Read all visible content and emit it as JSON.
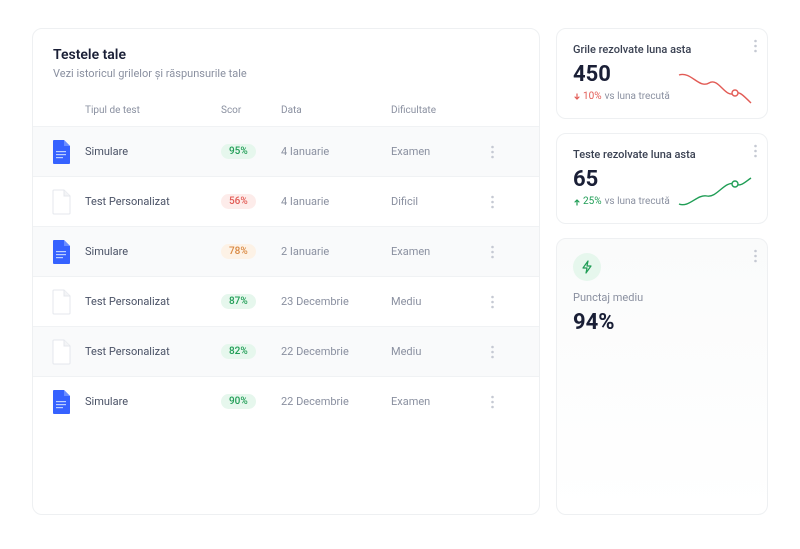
{
  "panel": {
    "title": "Testele tale",
    "subtitle": "Vezi istoricul grilelor și răspunsurile tale",
    "columns": {
      "type": "Tipul de test",
      "score": "Scor",
      "date": "Data",
      "difficulty": "Dificultate"
    },
    "rows": [
      {
        "name": "Simulare",
        "score": "95%",
        "score_tone": "green",
        "date": "4 Ianuarie",
        "difficulty": "Examen",
        "icon": "blue",
        "alt": true
      },
      {
        "name": "Test Personalizat",
        "score": "56%",
        "score_tone": "red",
        "date": "4 Ianuarie",
        "difficulty": "Dificil",
        "icon": "white",
        "alt": false
      },
      {
        "name": "Simulare",
        "score": "78%",
        "score_tone": "orange",
        "date": "2 Ianuarie",
        "difficulty": "Examen",
        "icon": "blue",
        "alt": true
      },
      {
        "name": "Test Personalizat",
        "score": "87%",
        "score_tone": "green",
        "date": "23 Decembrie",
        "difficulty": "Mediu",
        "icon": "white",
        "alt": false
      },
      {
        "name": "Test Personalizat",
        "score": "82%",
        "score_tone": "green",
        "date": "22 Decembrie",
        "difficulty": "Mediu",
        "icon": "white",
        "alt": true
      },
      {
        "name": "Simulare",
        "score": "90%",
        "score_tone": "green",
        "date": "22 Decembrie",
        "difficulty": "Examen",
        "icon": "blue",
        "alt": false
      }
    ]
  },
  "cards": {
    "grids": {
      "title": "Grile rezolvate luna asta",
      "value": "450",
      "delta": "10%",
      "delta_dir": "down",
      "vs": "vs luna trecută"
    },
    "tests": {
      "title": "Teste rezolvate luna asta",
      "value": "65",
      "delta": "25%",
      "delta_dir": "up",
      "vs": "vs luna trecută"
    },
    "avg": {
      "label": "Punctaj mediu",
      "value": "94%"
    }
  }
}
